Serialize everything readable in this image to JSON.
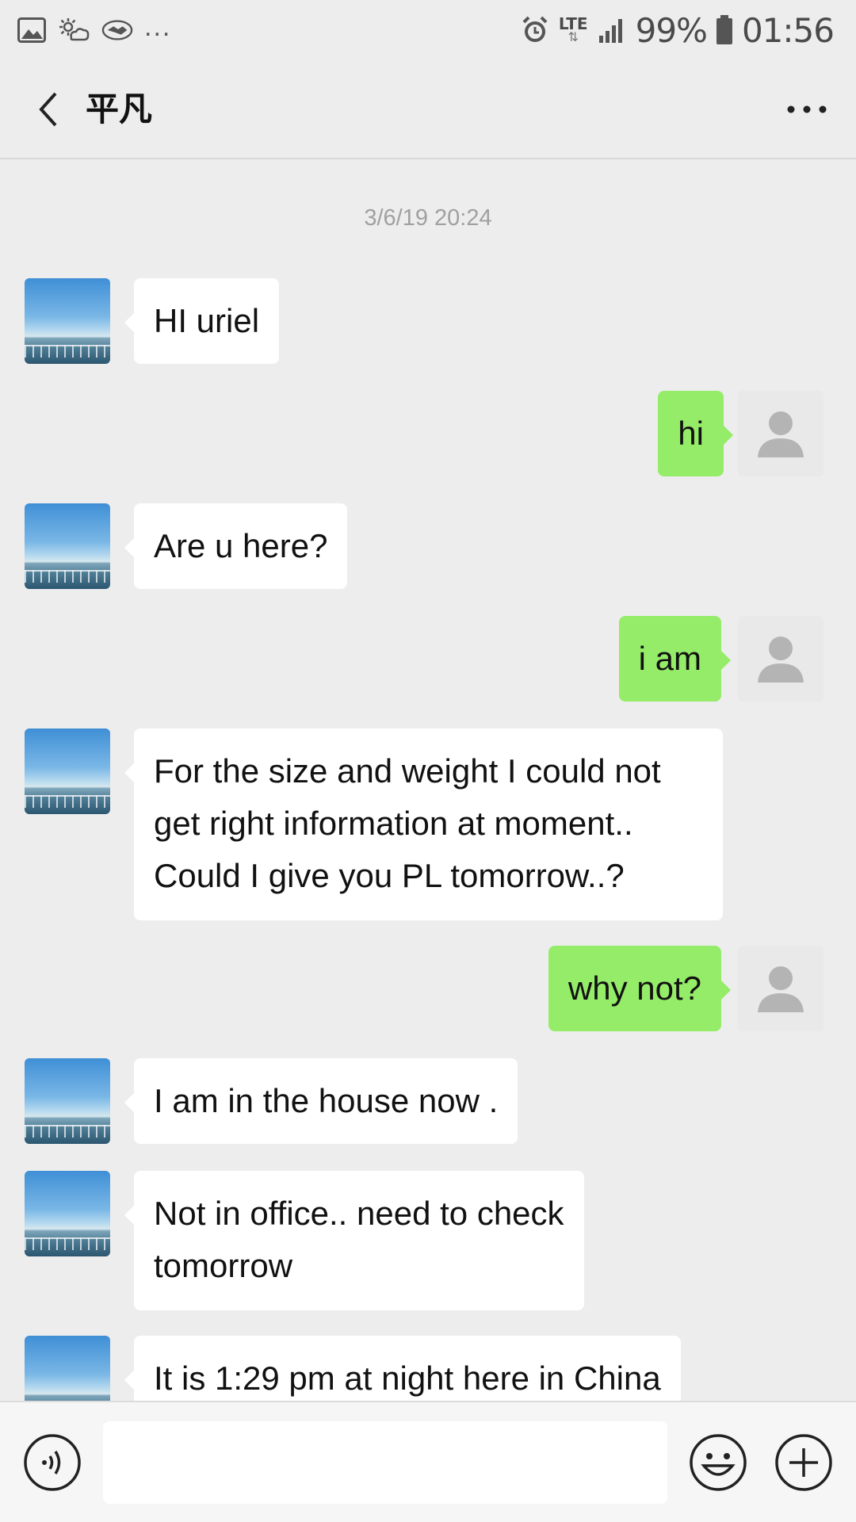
{
  "status_bar": {
    "left_icons": [
      "gallery-icon",
      "weather-icon",
      "handshake-icon"
    ],
    "overflow": "...",
    "network": "LTE",
    "battery": "99%",
    "time": "01:56"
  },
  "header": {
    "title": "平凡"
  },
  "chat": {
    "timestamp": "3/6/19 20:24",
    "messages": [
      {
        "from": "contact",
        "lines": [
          "HI uriel"
        ]
      },
      {
        "from": "me",
        "lines": [
          "hi"
        ]
      },
      {
        "from": "contact",
        "lines": [
          "Are u here?"
        ]
      },
      {
        "from": "me",
        "lines": [
          "i am"
        ]
      },
      {
        "from": "contact",
        "lines": [
          "For the size and weight I could not",
          "get right information at moment..",
          "Could I give you PL tomorrow..?"
        ]
      },
      {
        "from": "me",
        "lines": [
          "why not?"
        ]
      },
      {
        "from": "contact",
        "lines": [
          "I am in the house now ."
        ]
      },
      {
        "from": "contact",
        "lines": [
          "Not in office.. need to check",
          "tomorrow"
        ]
      },
      {
        "from": "contact",
        "lines": [
          "It is 1:29 pm at night here in China"
        ]
      }
    ]
  },
  "input_bar": {
    "placeholder": "",
    "value": ""
  },
  "colors": {
    "background": "#ededed",
    "incoming_bubble": "#ffffff",
    "outgoing_bubble": "#95ec69",
    "timestamp": "#a0a0a0"
  }
}
